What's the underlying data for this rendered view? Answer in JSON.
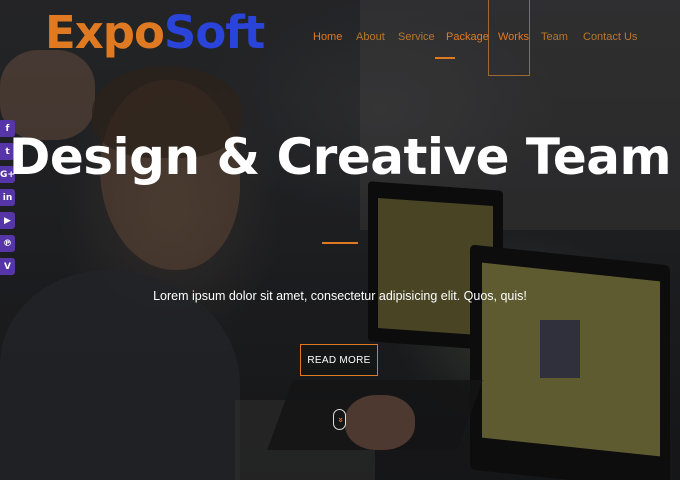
{
  "brand": {
    "logo_part1": "Expo",
    "logo_part2": "Soft"
  },
  "nav": {
    "items": [
      {
        "label": "Home"
      },
      {
        "label": "About"
      },
      {
        "label": "Service"
      },
      {
        "label": "Package"
      },
      {
        "label": "Works"
      },
      {
        "label": "Team"
      },
      {
        "label": "Contact Us"
      }
    ]
  },
  "social": {
    "icons": [
      {
        "name": "facebook-icon",
        "glyph": "f"
      },
      {
        "name": "twitter-icon",
        "glyph": "t"
      },
      {
        "name": "google-plus-icon",
        "glyph": "G+"
      },
      {
        "name": "linkedin-icon",
        "glyph": "in"
      },
      {
        "name": "youtube-icon",
        "glyph": "▶"
      },
      {
        "name": "pinterest-icon",
        "glyph": "℗"
      },
      {
        "name": "vimeo-icon",
        "glyph": "V"
      }
    ]
  },
  "hero": {
    "title": "Design & Creative Team",
    "subtitle": "Lorem ipsum dolor sit amet, consectetur adipisicing elit. Quos, quis!",
    "button_label": "READ MORE",
    "scroll_glyph": "»"
  },
  "colors": {
    "accent": "#e07a22",
    "brand_blue": "#2a43d8",
    "social_bg": "#5535a8"
  }
}
